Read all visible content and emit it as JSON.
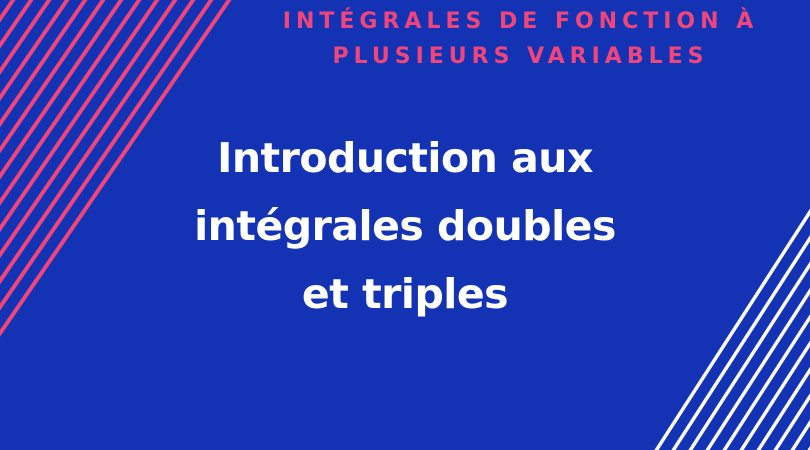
{
  "slide": {
    "subtitle_line1": "INTÉGRALES DE FONCTION À",
    "subtitle_line2": "PLUSIEURS VARIABLES",
    "title_line1": "Introduction aux",
    "title_line2": "intégrales doubles",
    "title_line3": "et triples"
  },
  "colors": {
    "background": "#1433b4",
    "accent_pink": "#f0457a",
    "stripe_white": "#ffffff",
    "title_text": "#ffffff"
  }
}
